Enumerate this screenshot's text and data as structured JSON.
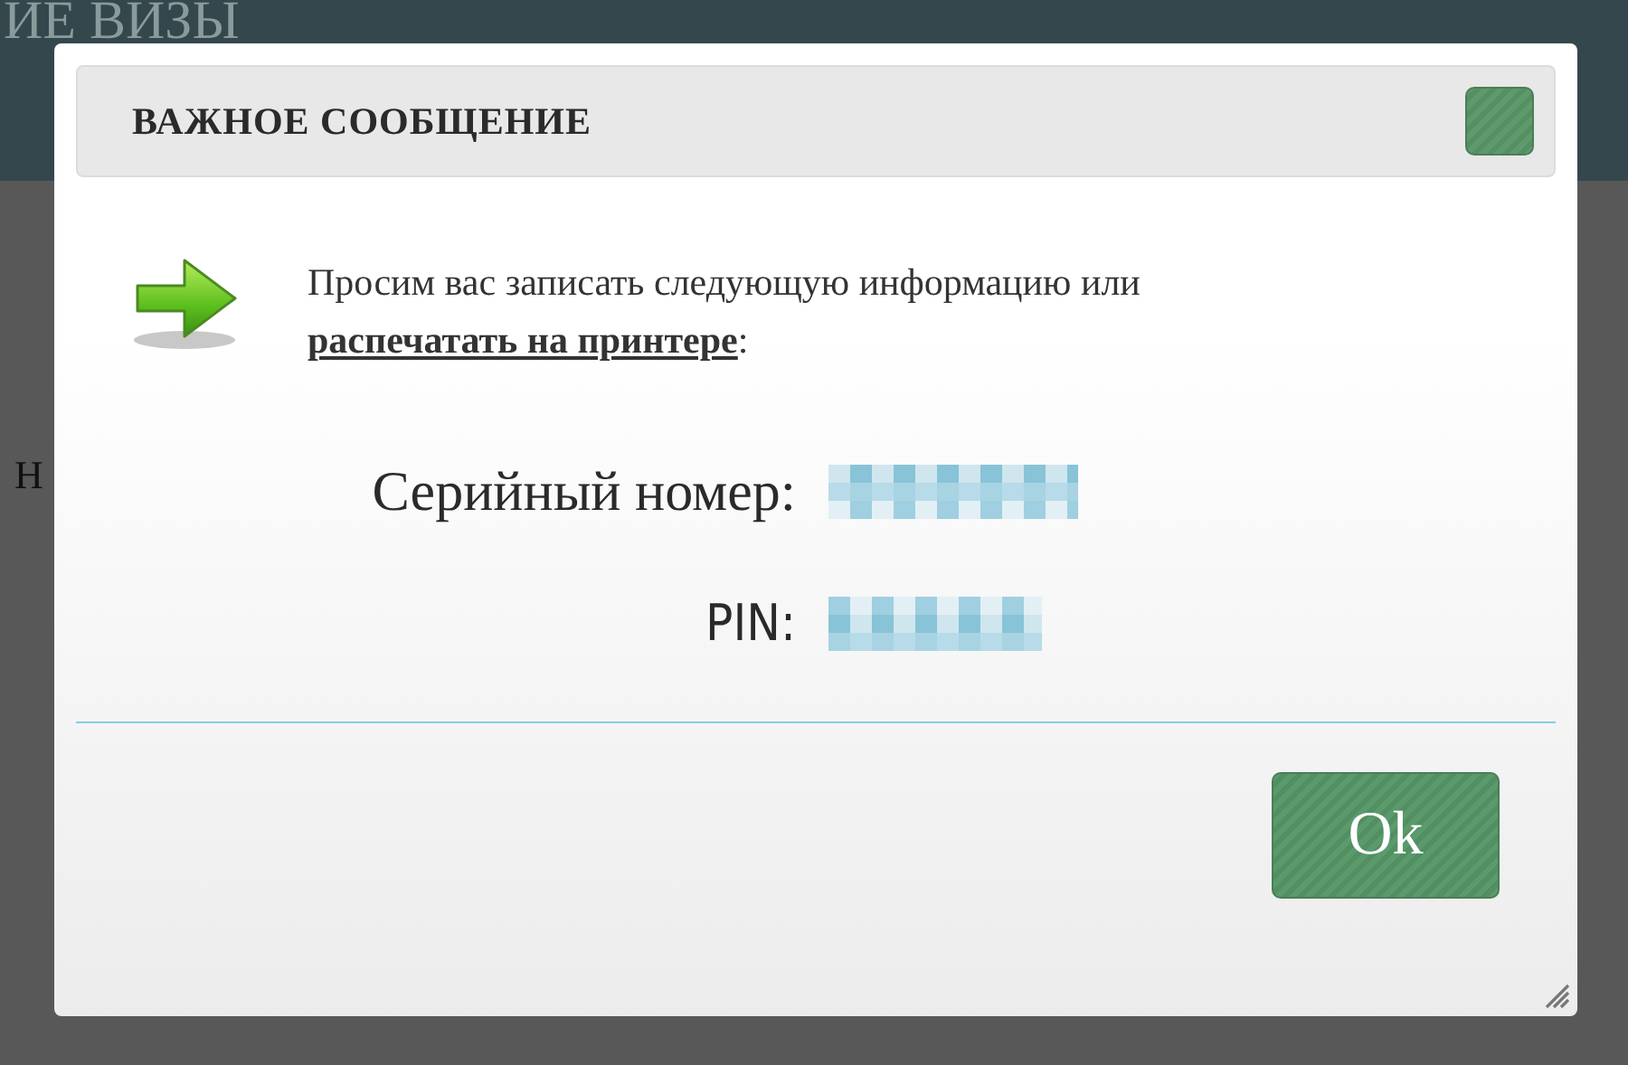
{
  "page": {
    "header_text": "ИЕ ВИЗЫ",
    "side_text": "Н"
  },
  "dialog": {
    "title": "ВАЖНОЕ СООБЩЕНИЕ",
    "message": "Просим вас записать следующую информацию или",
    "link": "распечатать на принтере",
    "message_end": ":",
    "fields": [
      {
        "label": "Серийный номер:",
        "kind": "redacted"
      },
      {
        "label": "PIN:",
        "kind": "redacted"
      }
    ],
    "button": "Ok"
  }
}
